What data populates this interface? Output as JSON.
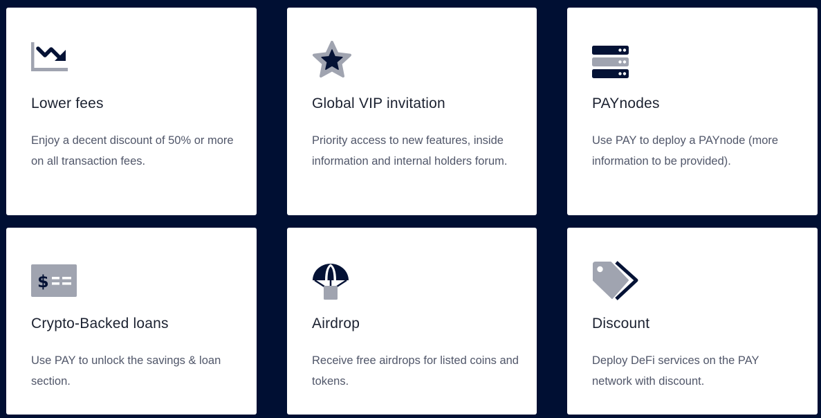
{
  "colors": {
    "background": "#000f33",
    "card": "#ffffff",
    "icon_dark": "#041235",
    "icon_grey": "#a0a4b0",
    "title": "#1b2130",
    "text": "#505669"
  },
  "features": [
    {
      "icon": "chart-down-icon",
      "title": "Lower fees",
      "description": "Enjoy a decent discount of 50% or more on all transaction fees."
    },
    {
      "icon": "star-icon",
      "title": "Global VIP invitation",
      "description": "Priority access to new features, inside information and internal holders forum."
    },
    {
      "icon": "server-icon",
      "title": "PAYnodes",
      "description": "Use PAY to deploy a PAYnode (more information to be provided)."
    },
    {
      "icon": "money-check-icon",
      "title": "Crypto-Backed loans",
      "description": "Use PAY to unlock the savings & loan section."
    },
    {
      "icon": "parachute-box-icon",
      "title": "Airdrop",
      "description": "Receive free airdrops for listed coins and tokens."
    },
    {
      "icon": "tags-icon",
      "title": "Discount",
      "description": "Deploy DeFi services on the PAY network with discount."
    }
  ]
}
